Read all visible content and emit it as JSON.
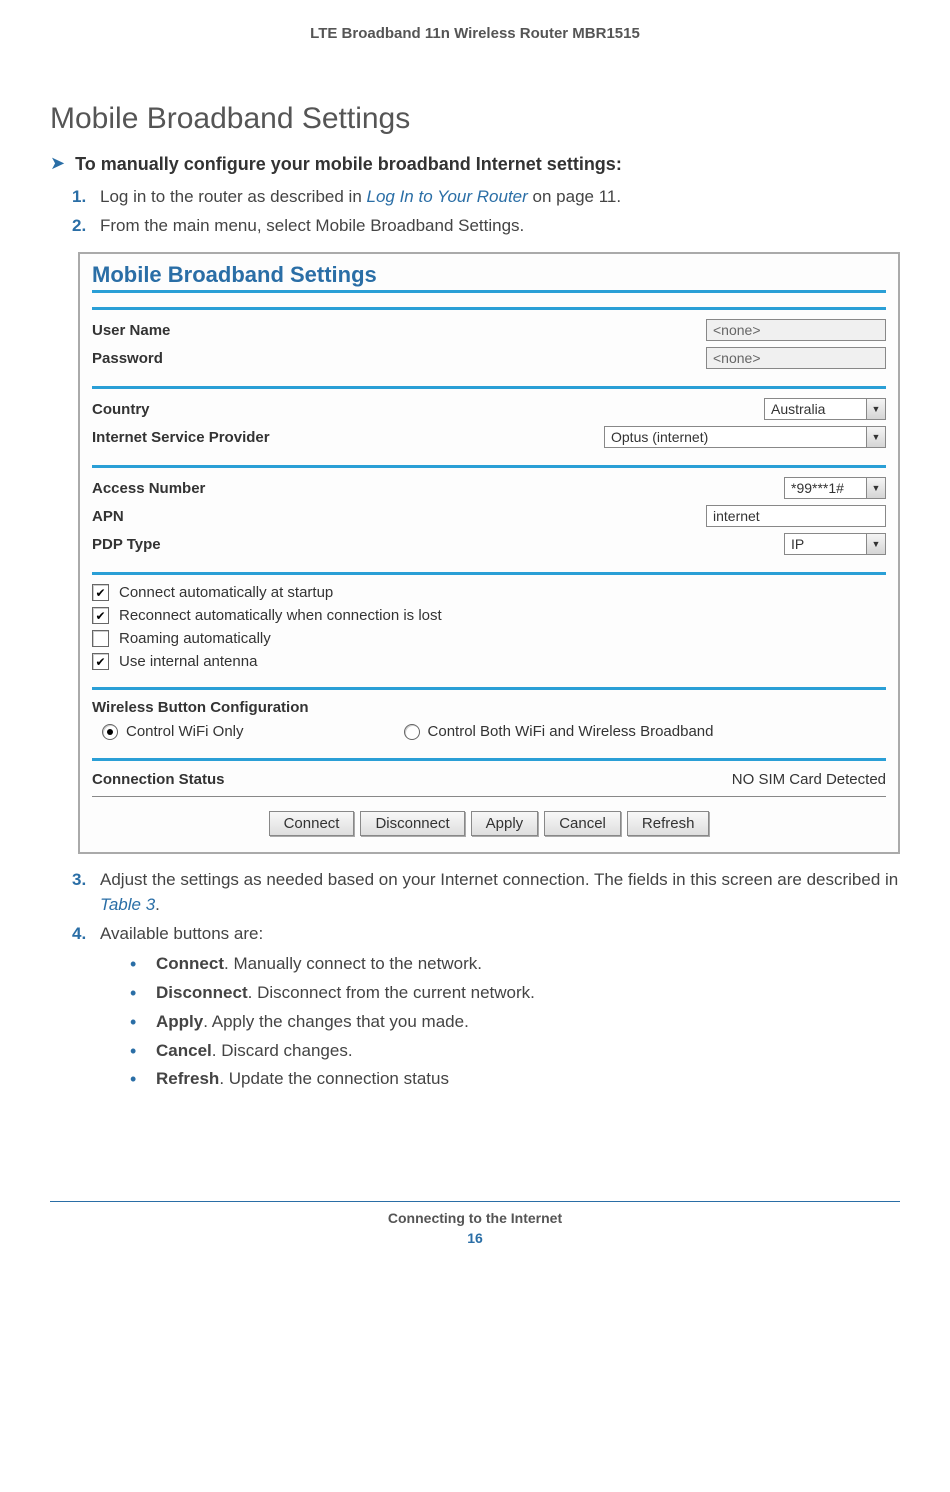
{
  "header": {
    "product": "LTE Broadband 11n Wireless Router MBR1515"
  },
  "title": "Mobile Broadband Settings",
  "procedure_heading": "To manually configure your mobile broadband Internet settings:",
  "steps": {
    "s1": {
      "num": "1.",
      "pre": "Log in to the router as described in ",
      "link": "Log In to Your Router",
      "post": " on page 11."
    },
    "s2": {
      "num": "2.",
      "text": "From the main menu, select Mobile Broadband Settings."
    },
    "s3": {
      "num": "3.",
      "pre": "Adjust the settings as needed based on your Internet connection. The fields in this screen are described in ",
      "link": "Table 3",
      "post": "."
    },
    "s4": {
      "num": "4.",
      "text": "Available buttons are:"
    }
  },
  "panel": {
    "title": "Mobile Broadband Settings",
    "user_name_label": "User Name",
    "user_name_value": "<none>",
    "password_label": "Password",
    "password_value": "<none>",
    "country_label": "Country",
    "country_value": "Australia",
    "isp_label": "Internet Service Provider",
    "isp_value": "Optus (internet)",
    "access_number_label": "Access Number",
    "access_number_value": "*99***1#",
    "apn_label": "APN",
    "apn_value": "internet",
    "pdp_type_label": "PDP Type",
    "pdp_type_value": "IP",
    "chk_startup": "Connect automatically at startup",
    "chk_reconnect": "Reconnect automatically when connection is lost",
    "chk_roaming": "Roaming automatically",
    "chk_antenna": "Use internal antenna",
    "wireless_btn_cfg": "Wireless Button Configuration",
    "radio_wifi_only": "Control WiFi Only",
    "radio_both": "Control Both WiFi and Wireless Broadband",
    "conn_status_label": "Connection Status",
    "conn_status_value": "NO SIM Card Detected",
    "buttons": {
      "connect": "Connect",
      "disconnect": "Disconnect",
      "apply": "Apply",
      "cancel": "Cancel",
      "refresh": "Refresh"
    }
  },
  "bullets": {
    "connect": {
      "label": "Connect",
      "desc": ". Manually connect to the network."
    },
    "disconnect": {
      "label": "Disconnect",
      "desc": ". Disconnect from the current network."
    },
    "apply": {
      "label": "Apply",
      "desc": ". Apply the changes that you made."
    },
    "cancel": {
      "label": "Cancel",
      "desc": ". Discard changes."
    },
    "refresh": {
      "label": "Refresh",
      "desc": ". Update the connection status"
    }
  },
  "footer": {
    "chapter": "Connecting to the Internet",
    "page": "16"
  }
}
